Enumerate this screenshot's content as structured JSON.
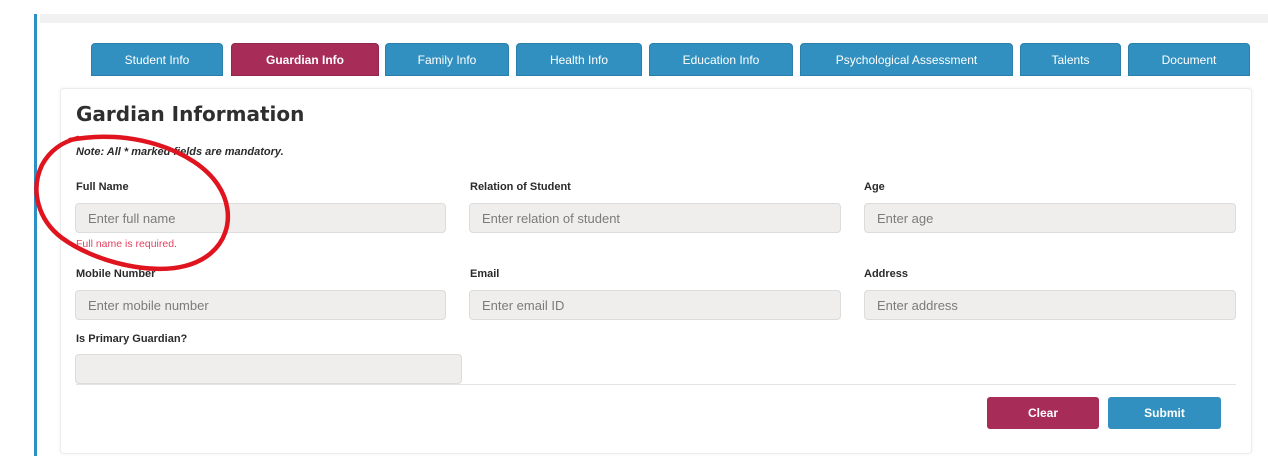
{
  "tabs": [
    {
      "label": "Student Info",
      "active": false
    },
    {
      "label": "Guardian Info",
      "active": true
    },
    {
      "label": "Family Info",
      "active": false
    },
    {
      "label": "Health Info",
      "active": false
    },
    {
      "label": "Education Info",
      "active": false
    },
    {
      "label": "Psychological Assessment",
      "active": false
    },
    {
      "label": "Talents",
      "active": false
    },
    {
      "label": "Document",
      "active": false
    }
  ],
  "form": {
    "title": "Gardian Information",
    "note": "Note: All * marked fields are mandatory.",
    "full_name": {
      "label": "Full Name",
      "placeholder": "Enter full name",
      "error": "Full name is required."
    },
    "relation": {
      "label": "Relation of Student",
      "placeholder": "Enter relation of student"
    },
    "age": {
      "label": "Age",
      "placeholder": "Enter age"
    },
    "mobile": {
      "label": "Mobile Number",
      "placeholder": "Enter mobile number"
    },
    "email": {
      "label": "Email",
      "placeholder": "Enter email ID"
    },
    "address": {
      "label": "Address",
      "placeholder": "Enter address"
    },
    "primary_guardian": {
      "label": "Is Primary Guardian?",
      "value": ""
    }
  },
  "buttons": {
    "clear": "Clear",
    "submit": "Submit"
  },
  "colors": {
    "primary": "#3190c0",
    "accent": "#a72c58",
    "error": "#e0435f",
    "annotation": "#e0141e"
  }
}
